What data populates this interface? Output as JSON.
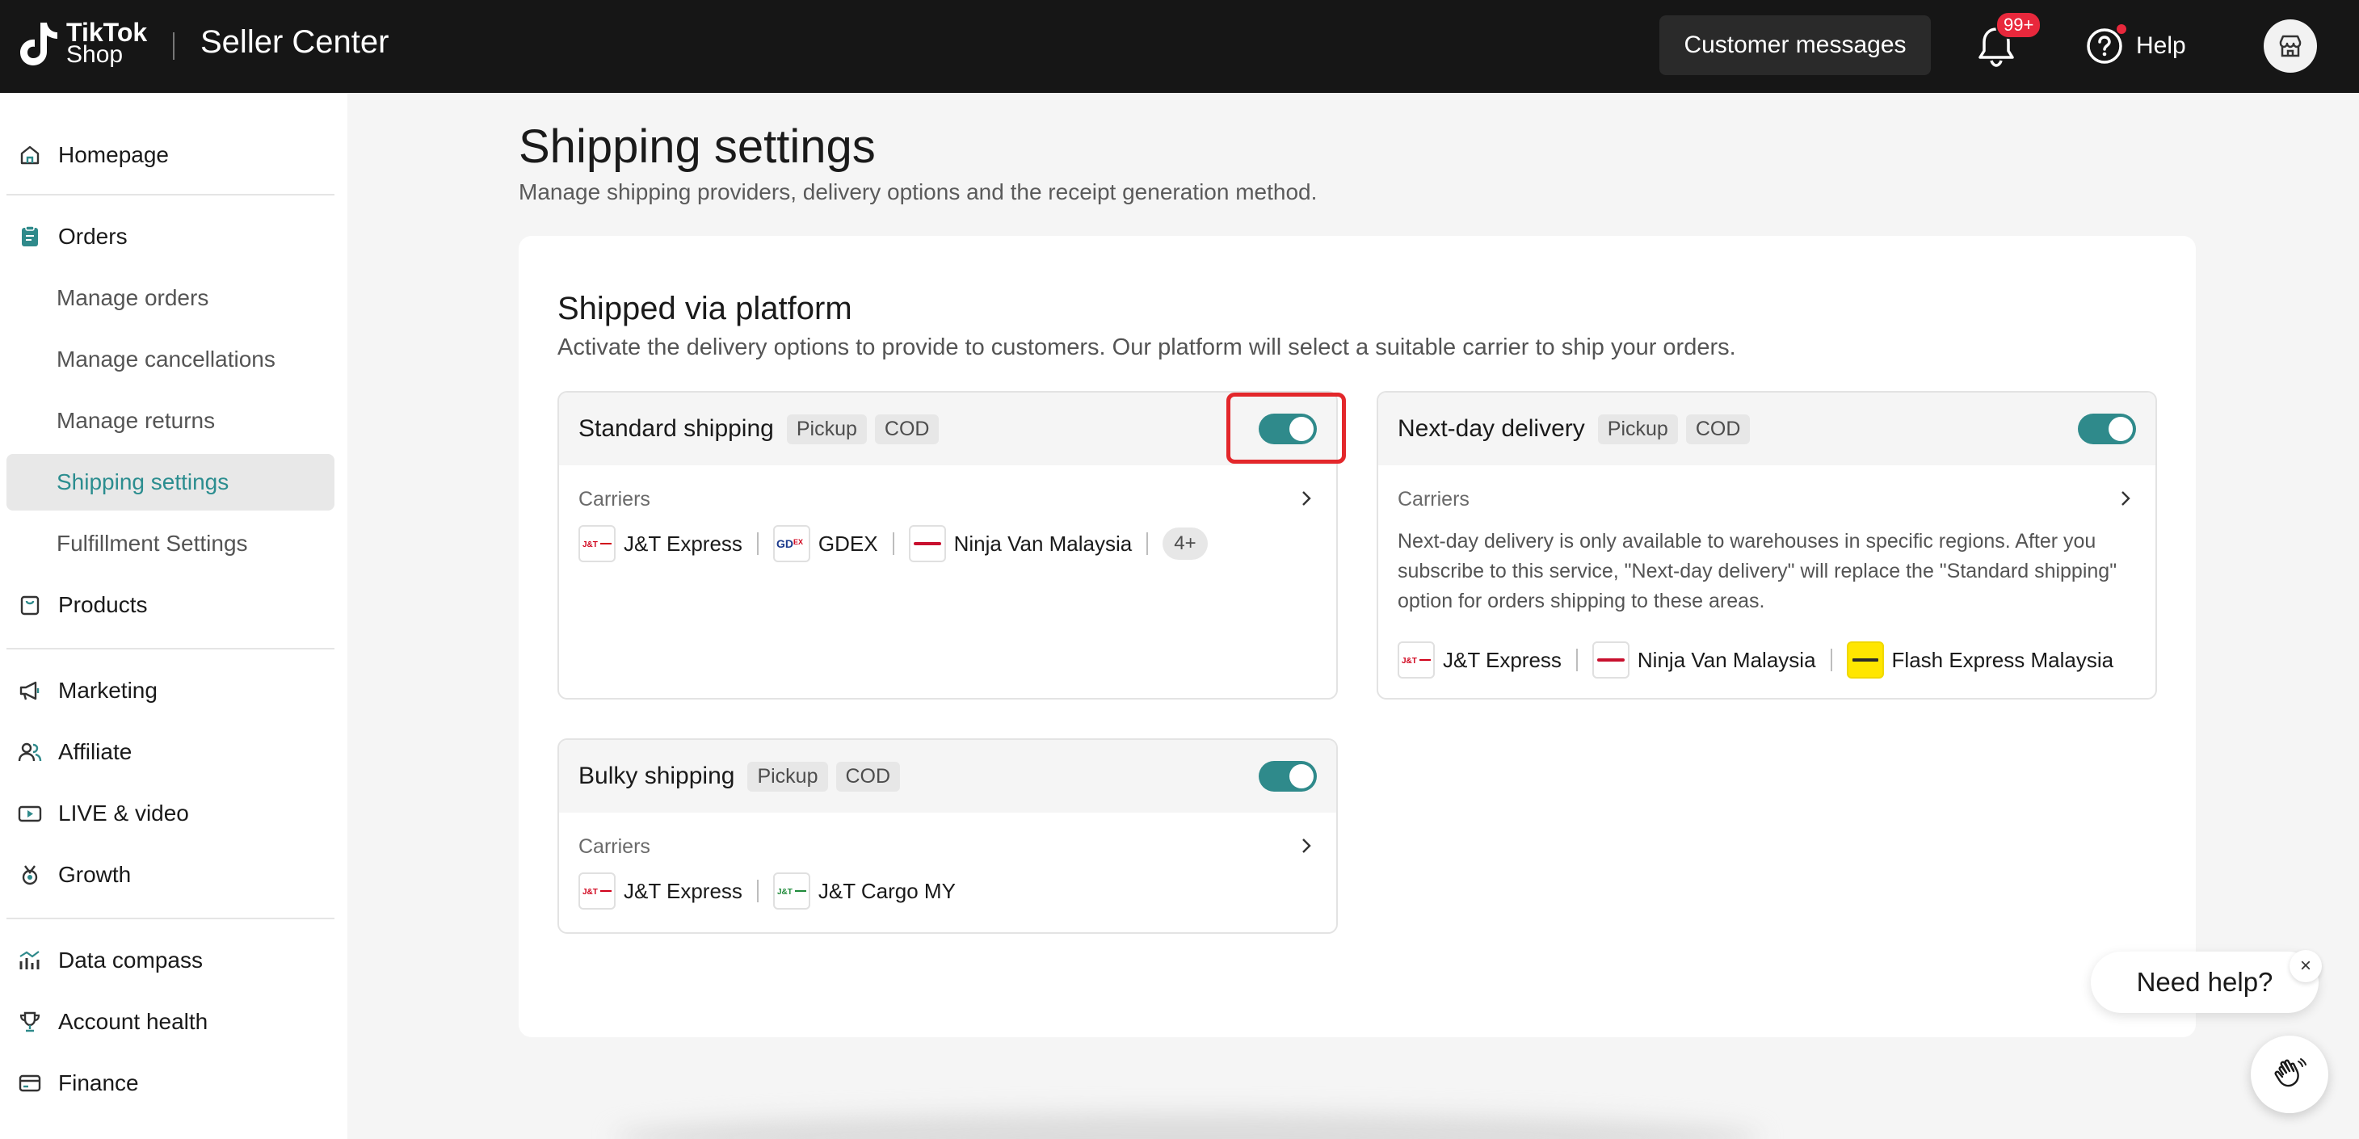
{
  "header": {
    "logo_line1": "TikTok",
    "logo_line2": "Shop",
    "app_title": "Seller Center",
    "customer_messages_label": "Customer messages",
    "notification_badge": "99+",
    "help_label": "Help"
  },
  "sidebar": {
    "items": [
      {
        "label": "Homepage",
        "icon": "home-icon"
      },
      {
        "label": "Orders",
        "icon": "orders-icon"
      },
      {
        "label": "Manage orders"
      },
      {
        "label": "Manage cancellations"
      },
      {
        "label": "Manage returns"
      },
      {
        "label": "Shipping settings",
        "active": true
      },
      {
        "label": "Fulfillment Settings"
      },
      {
        "label": "Products",
        "icon": "products-icon"
      },
      {
        "label": "Marketing",
        "icon": "megaphone-icon"
      },
      {
        "label": "Affiliate",
        "icon": "affiliate-icon"
      },
      {
        "label": "LIVE & video",
        "icon": "video-icon"
      },
      {
        "label": "Growth",
        "icon": "growth-icon"
      },
      {
        "label": "Data compass",
        "icon": "chart-icon"
      },
      {
        "label": "Account health",
        "icon": "trophy-icon"
      },
      {
        "label": "Finance",
        "icon": "card-icon"
      }
    ]
  },
  "page": {
    "title": "Shipping settings",
    "subtitle": "Manage shipping providers, delivery options and the receipt generation method."
  },
  "section": {
    "title": "Shipped via platform",
    "subtitle": "Activate the delivery options to provide to customers. Our platform will select a suitable carrier to ship your orders."
  },
  "cards": {
    "standard": {
      "name": "Standard shipping",
      "tags": [
        "Pickup",
        "COD"
      ],
      "enabled": true,
      "carriers_label": "Carriers",
      "carriers": [
        "J&T Express",
        "GDEX",
        "Ninja Van Malaysia"
      ],
      "more": "4+"
    },
    "nextday": {
      "name": "Next-day delivery",
      "tags": [
        "Pickup",
        "COD"
      ],
      "enabled": true,
      "carriers_label": "Carriers",
      "description": "Next-day delivery is only available to warehouses in specific regions. After you subscribe to this service, \"Next-day delivery\" will replace the \"Standard shipping\" option for orders shipping to these areas.",
      "carriers": [
        "J&T Express",
        "Ninja Van Malaysia",
        "Flash Express Malaysia"
      ]
    },
    "bulky": {
      "name": "Bulky shipping",
      "tags": [
        "Pickup",
        "COD"
      ],
      "enabled": true,
      "carriers_label": "Carriers",
      "carriers": [
        "J&T Express",
        "J&T Cargo MY"
      ]
    }
  },
  "help_widget": {
    "label": "Need help?",
    "close": "×"
  },
  "colors": {
    "accent": "#2f8a8b",
    "topbar": "#161616",
    "highlight": "#e3272b",
    "badge": "#e8283c"
  }
}
